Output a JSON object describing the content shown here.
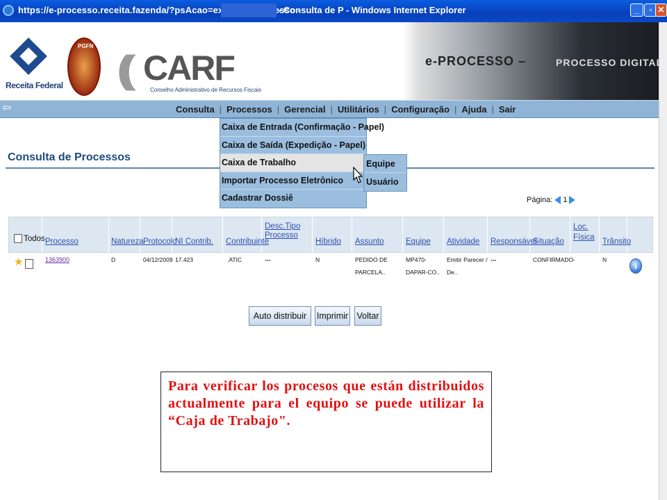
{
  "window": {
    "title_left": "https://e-processo.receita.fazenda/?psAcao=exibir - e-Processo -",
    "title_right": "- Consulta de P - Windows Internet Explorer",
    "controls": [
      "_",
      "▫",
      "✕"
    ]
  },
  "header": {
    "receita_label": "Receita Federal",
    "pgfn_label": "PGFN",
    "carf_logo": "CARF",
    "carf_subtitle": "Conselho Administrativo de Recursos Fiscais",
    "banner_title": "e-PROCESSO –",
    "banner_title2": "PROCESSO DIGITAL"
  },
  "nav": {
    "back_icon": "⇦",
    "items": [
      "Consulta",
      "Processos",
      "Gerencial",
      "Utilitários",
      "Configuração",
      "Ajuda",
      "Sair"
    ]
  },
  "dropdown": {
    "items": [
      "Caixa de Entrada (Confirmação - Papel)",
      "Caixa de Saída (Expedição - Papel)",
      "Caixa de Trabalho",
      "Importar Processo Eletrônico",
      "Cadastrar Dossiê"
    ],
    "submenu": [
      "Equipe",
      "Usuário"
    ]
  },
  "page": {
    "title": "Consulta de Processos",
    "pagina_label": "Página:",
    "pagina_num": "1"
  },
  "table": {
    "todos": "Todos",
    "headers": [
      "Processo",
      "Natureza",
      "Protocolo",
      "NI Contrib.",
      "Contribuinte",
      "Desc.Tipo Processo",
      "Híbrido",
      "Assunto",
      "Equipe",
      "Atividade",
      "Responsável",
      "Situação",
      "Loc. Física",
      "Trânsito"
    ],
    "row": {
      "processo": "1363900",
      "natureza": "D",
      "protocolo": "04/12/2009",
      "ni": "17.423",
      "contribuinte": ".ATIC",
      "desc": "---",
      "hibrido": "N",
      "assunto_1": "PEDIDO DE",
      "assunto_2": "PARCELA..",
      "equipe_1": "MP470-",
      "equipe_2": "DAPAR-CO..",
      "atividade_1": "Emitir Parecer /",
      "atividade_2": "De..",
      "responsavel": "---",
      "situacao": "CONFIRMADO",
      "loc": "-",
      "transito": "N"
    }
  },
  "buttons": {
    "auto": "Auto distribuir",
    "imprimir": "Imprimir",
    "voltar": "Voltar"
  },
  "note": {
    "text": "Para verificar los procesos que están distribuidos actualmente para el equipo se puede utilizar  la “Caja de Trabajo\"."
  }
}
